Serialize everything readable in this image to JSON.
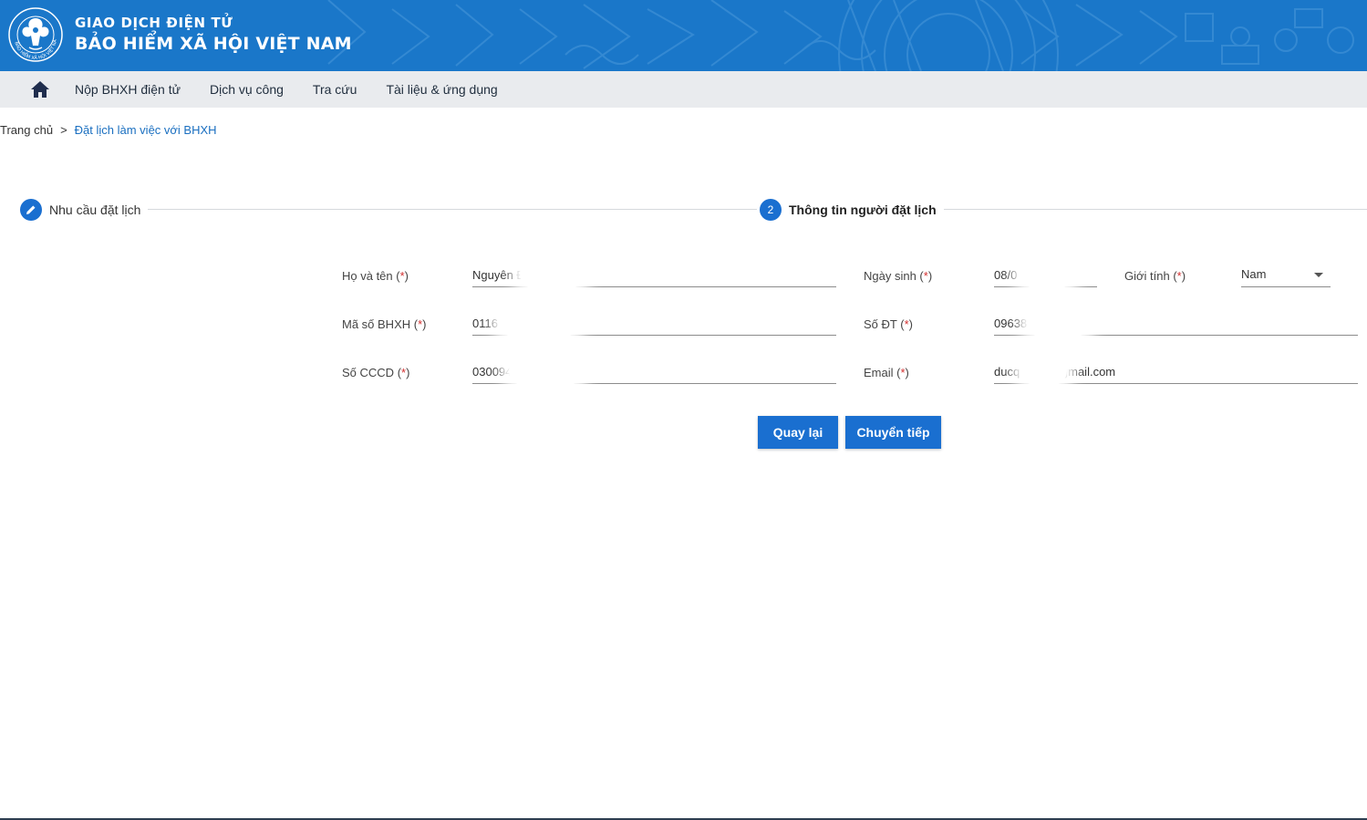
{
  "header": {
    "brand_line1": "GIAO DỊCH ĐIỆN TỬ",
    "brand_line2": "BẢO HIỂM XÃ HỘI VIỆT NAM",
    "logo_ring_text": "BẢO HIỂM XÃ HỘI VIỆT NAM",
    "background_color": "#1a77c9"
  },
  "nav": {
    "home_icon": "home-icon",
    "items": [
      {
        "label": "Nộp BHXH điện tử"
      },
      {
        "label": "Dịch vụ công"
      },
      {
        "label": "Tra cứu"
      },
      {
        "label": "Tài liệu & ứng dụng"
      }
    ]
  },
  "breadcrumb": {
    "home": "Trang chủ",
    "separator": ">",
    "current": "Đặt lịch làm việc với BHXH"
  },
  "stepper": {
    "steps": [
      {
        "icon": "pencil-icon",
        "label": "Nhu cầu đặt lịch"
      },
      {
        "number": "2",
        "label": "Thông tin người đặt lịch"
      }
    ]
  },
  "form": {
    "required_mark": "*",
    "fields": {
      "ho_ten": {
        "label": "Họ và tên",
        "value": "Nguyên Đ"
      },
      "ngay_sinh": {
        "label": "Ngày sinh",
        "value": "08/0"
      },
      "gioi_tinh": {
        "label": "Giới tính",
        "value": "Nam"
      },
      "ma_so_bhxh": {
        "label": "Mã số BHXH",
        "value": "0116"
      },
      "so_dt": {
        "label": "Số ĐT",
        "value": "09638"
      },
      "so_cccd": {
        "label": "Số CCCD",
        "value": "030094"
      },
      "email": {
        "label": "Email",
        "value": "ducq         @gmail.com"
      }
    }
  },
  "buttons": {
    "back": "Quay lại",
    "next": "Chuyển tiếp"
  },
  "colors": {
    "primary": "#1a6fd0",
    "nav_bg": "#e9ebee",
    "required": "#d32f2f"
  }
}
